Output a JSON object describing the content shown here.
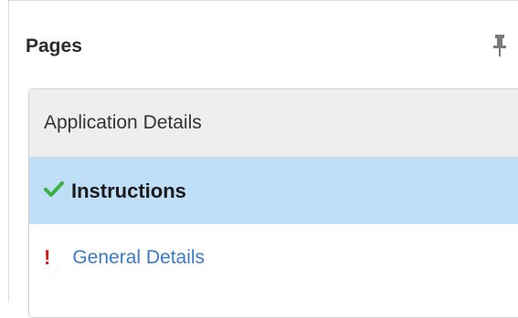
{
  "panel": {
    "title": "Pages"
  },
  "pages": {
    "group_label": "Application Details",
    "items": [
      {
        "label": "Instructions",
        "status": "complete"
      },
      {
        "label": "General Details",
        "status": "error",
        "status_glyph": "!"
      }
    ]
  },
  "colors": {
    "active_bg": "#bfdef8",
    "check": "#3cb043",
    "error": "#e01010",
    "link": "#3a7bc4"
  }
}
